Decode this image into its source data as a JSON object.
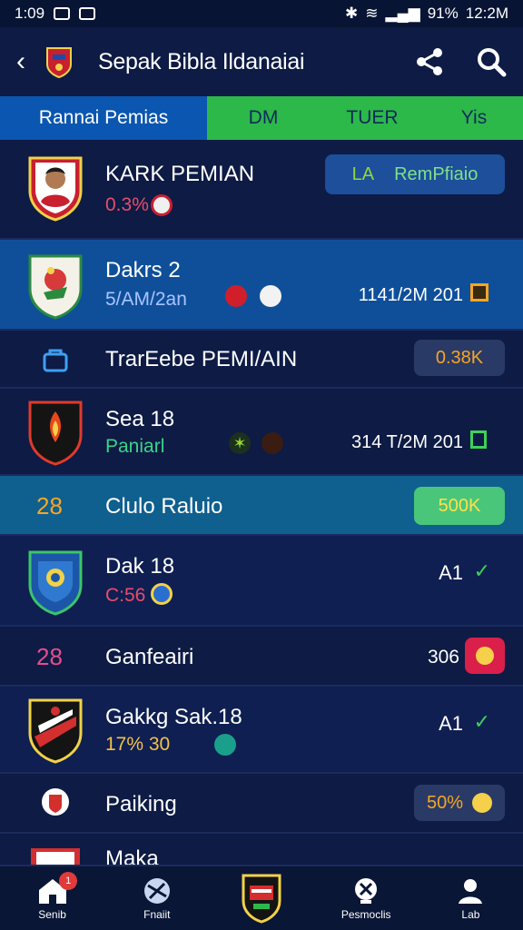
{
  "status": {
    "time": "1:09",
    "battery": "91%",
    "clock": "12:2M"
  },
  "app": {
    "title": "Sepak Bibla Ildanaiai",
    "back_icon": "chevron-left-icon",
    "share_icon": "share-icon",
    "search_icon": "search-icon"
  },
  "tabs": [
    {
      "label": "Rannai Pemias"
    },
    {
      "label": "DM"
    },
    {
      "label": "TUER"
    },
    {
      "label": "Yis"
    }
  ],
  "profile": {
    "name": "KARK PEMIAN",
    "stat": "0.3%",
    "action_icon": "LA",
    "action_label": "RemPfiaio"
  },
  "rows": [
    {
      "title": "Dakrs 2",
      "sub": "5/AM/2an",
      "date": "1141/2M 201"
    },
    {
      "title": "TrarEebe PEMI/AIN",
      "pill": "0.38K"
    },
    {
      "title": "Sea 18",
      "sub": "Paniarl",
      "date": "314 T/2M 201"
    },
    {
      "number": "28",
      "title": "Clulo Raluio",
      "pill": "500K"
    },
    {
      "title": "Dak 18",
      "sub": "C:56",
      "score": "A1"
    },
    {
      "number": "28",
      "title": "Ganfeairi",
      "value": "306"
    },
    {
      "title": "Gakkg Sak.18",
      "sub": "17% 30",
      "score": "A1"
    },
    {
      "title": "Paiking",
      "pill": "50%"
    },
    {
      "title": "Maka"
    }
  ],
  "nav": [
    {
      "label": "Senib",
      "badge": "1"
    },
    {
      "label": "Fnaiit"
    },
    {
      "label": ""
    },
    {
      "label": "Pesmoclis"
    },
    {
      "label": "Lab"
    }
  ]
}
